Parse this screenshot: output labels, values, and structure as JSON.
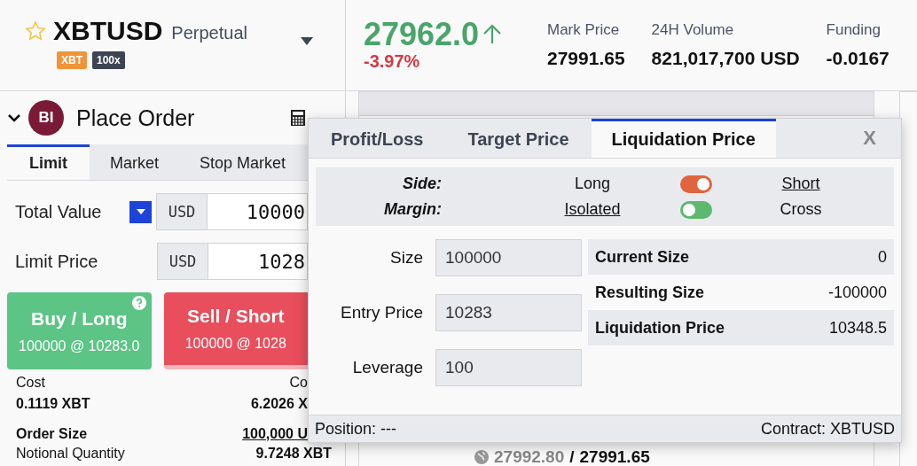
{
  "instrument": {
    "favorite": false,
    "symbol": "XBTUSD",
    "type": "Perpetual",
    "badges": [
      {
        "label": "XBT",
        "color": "#f0943a"
      },
      {
        "label": "100x",
        "color": "#3d4452"
      }
    ]
  },
  "ticker": {
    "last_price": "27962.0",
    "change": "-3.97%",
    "stats": [
      {
        "label": "Mark Price",
        "value": "27991.65"
      },
      {
        "label": "24H Volume",
        "value": "821,017,700 USD"
      },
      {
        "label": "Funding",
        "value": "-0.0167"
      }
    ]
  },
  "place_order": {
    "avatar": "BI",
    "title": "Place Order",
    "tabs": [
      {
        "label": "Limit",
        "selected": true
      },
      {
        "label": "Market",
        "selected": false
      },
      {
        "label": "Stop Market",
        "selected": false
      }
    ],
    "fields": [
      {
        "label": "Total Value",
        "unit": "USD",
        "value": "10000",
        "has_menu": true
      },
      {
        "label": "Limit Price",
        "unit": "USD",
        "value": "1028",
        "has_menu": false
      }
    ],
    "actions": [
      {
        "kind": "buy",
        "title": "Buy / Long",
        "detail": "100000 @ 10283.0"
      },
      {
        "kind": "sell",
        "title": "Sell / Short",
        "detail": "100000 @ 1028"
      }
    ],
    "cost": {
      "left_label": "Cost",
      "left_value": "0.1119 XBT",
      "right_label": "Co",
      "right_value": "6.2026 X"
    },
    "order_size": {
      "label": "Order Size",
      "value": "100,000 U"
    },
    "notional": {
      "label": "Notional Quantity",
      "value": "9.7248 XBT"
    }
  },
  "order_book": {
    "index_price": "27992.80",
    "separator": "/",
    "mark_price": "27991.65"
  },
  "calculator": {
    "tabs": [
      {
        "label": "Profit/Loss",
        "selected": false
      },
      {
        "label": "Target Price",
        "selected": false
      },
      {
        "label": "Liquidation Price",
        "selected": true
      }
    ],
    "close": "X",
    "options": [
      {
        "label": "Side:",
        "color": "#e0653f",
        "choices": [
          {
            "label": "Long",
            "selected": false
          },
          {
            "label": "Short",
            "selected": true
          }
        ]
      },
      {
        "label": "Margin:",
        "color": "#5fb86f",
        "choices": [
          {
            "label": "Isolated",
            "selected": true
          },
          {
            "label": "Cross",
            "selected": false
          }
        ]
      }
    ],
    "inputs": [
      {
        "label": "Size",
        "value": "100000"
      },
      {
        "label": "Entry Price",
        "value": "10283"
      },
      {
        "label": "Leverage",
        "value": "100"
      }
    ],
    "results": [
      {
        "label": "Current Size",
        "value": "0"
      },
      {
        "label": "Resulting Size",
        "value": "-100000"
      },
      {
        "label": "Liquidation Price",
        "value": "10348.5"
      }
    ],
    "footer": {
      "position": "Position: ---",
      "contract": "Contract: XBTUSD"
    }
  }
}
